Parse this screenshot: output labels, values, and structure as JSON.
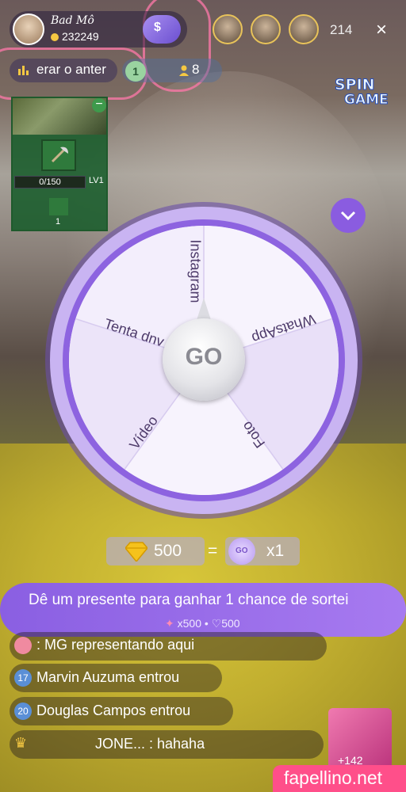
{
  "header": {
    "username": "Bad Mô",
    "coins": "232249",
    "viewer_count": "214",
    "close_label": "×"
  },
  "info_row": {
    "rank_text": "erar o anter",
    "level": "1",
    "people_count": "8"
  },
  "game_card": {
    "progress": "0/150",
    "level": "LV1",
    "item_count": "1"
  },
  "spin_logo": {
    "line1": "SPIN",
    "line2": "GAME"
  },
  "wheel": {
    "segments": [
      "Instagram",
      "WhatsApp",
      "Foto",
      "Vídeo",
      "Tenta dnv"
    ],
    "go_label": "GO"
  },
  "cost": {
    "diamonds": "500",
    "equals": "=",
    "go_mini": "GO",
    "chances": "x1"
  },
  "banner": {
    "title": "Dê um presente para ganhar 1 chance de sortei",
    "sub": "x500 • ♡500"
  },
  "chat": {
    "messages": [
      {
        "level": "",
        "text": ": MG representando aqui"
      },
      {
        "level": "17",
        "text": "Marvin Auzuma entrou"
      },
      {
        "level": "20",
        "text": "Douglas Campos entrou"
      },
      {
        "level": "",
        "text": "JONE... : hahaha"
      }
    ]
  },
  "gift": {
    "count": "+142"
  },
  "watermark": "fapellino.net",
  "colors": {
    "accent": "#8a5fe2",
    "wheel_ring": "#b793f0",
    "banner": "#9a6ce8"
  }
}
